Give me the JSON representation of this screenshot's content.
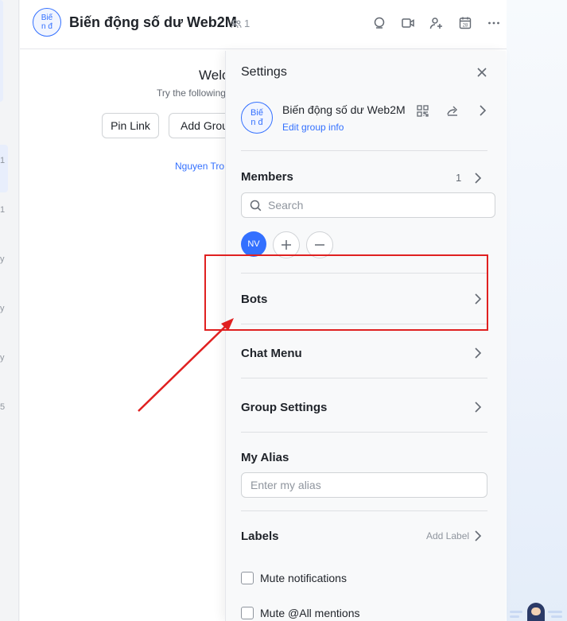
{
  "chat": {
    "avatar_line1": "Biế",
    "avatar_line2": "n đ",
    "title": "Biến động số dư Web2M",
    "member_count": "1",
    "welcome": "Welc",
    "try_text": "Try the following",
    "pin_link_label": "Pin Link",
    "add_group_label": "Add Grou",
    "creator": "Nguyen Tro"
  },
  "header_icons": [
    "search-chat-icon",
    "video-call-icon",
    "add-member-icon",
    "calendar-icon",
    "more-icon"
  ],
  "calendar_day": "28",
  "left_strip": [
    "1",
    "1",
    "y",
    "y",
    "y",
    "5"
  ],
  "settings": {
    "title": "Settings",
    "group": {
      "avatar_line1": "Biế",
      "avatar_line2": "n đ",
      "name": "Biến động số dư Web2M",
      "edit_info": "Edit group info"
    },
    "members": {
      "label": "Members",
      "count": "1",
      "search_placeholder": "Search",
      "avatar_initials": "NV"
    },
    "bots_label": "Bots",
    "chat_menu_label": "Chat Menu",
    "group_settings_label": "Group Settings",
    "alias": {
      "label": "My Alias",
      "placeholder": "Enter my alias"
    },
    "labels": {
      "label": "Labels",
      "add_label": "Add Label"
    },
    "mute_notifications": "Mute notifications",
    "mute_all_mentions": "Mute @All mentions"
  },
  "colors": {
    "accent": "#3370ff",
    "annotation": "#e02020"
  }
}
